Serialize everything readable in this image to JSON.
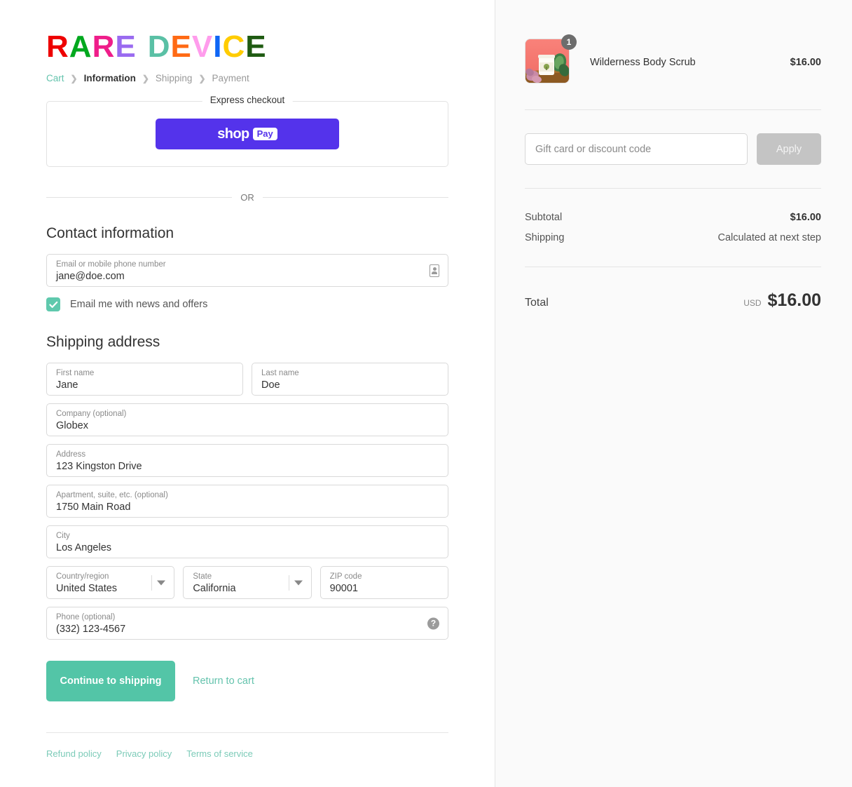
{
  "brand": {
    "letters": [
      {
        "ch": "R",
        "color": "#ee0000"
      },
      {
        "ch": "A",
        "color": "#00a81e"
      },
      {
        "ch": "R",
        "color": "#ef1d8a"
      },
      {
        "ch": "E",
        "color": "#9a6bf0"
      },
      {
        "ch": " ",
        "color": "#ffffff"
      },
      {
        "ch": "D",
        "color": "#5ac0a5"
      },
      {
        "ch": "E",
        "color": "#ff6a14"
      },
      {
        "ch": "V",
        "color": "#ff9cec"
      },
      {
        "ch": "I",
        "color": "#0f66f5"
      },
      {
        "ch": "C",
        "color": "#ffcc00"
      },
      {
        "ch": "E",
        "color": "#1f5b12"
      }
    ]
  },
  "breadcrumb": {
    "cart": "Cart",
    "information": "Information",
    "shipping": "Shipping",
    "payment": "Payment",
    "separator": "›"
  },
  "express": {
    "title": "Express checkout",
    "shoppay_word": "shop",
    "shoppay_badge": "Pay",
    "or": "OR"
  },
  "contact": {
    "heading": "Contact information",
    "email": {
      "label": "Email or mobile phone number",
      "value": "jane@doe.com"
    },
    "newsletter_label": "Email me with news and offers",
    "newsletter_checked": true
  },
  "shipping_address": {
    "heading": "Shipping address",
    "fields": [
      {
        "label": "First name",
        "value": "Jane"
      },
      {
        "label": "Last name",
        "value": "Doe"
      },
      {
        "label": "Company (optional)",
        "value": "Globex"
      },
      {
        "label": "Address",
        "value": "123 Kingston Drive"
      },
      {
        "label": "Apartment, suite, etc. (optional)",
        "value": "1750 Main Road"
      },
      {
        "label": "City",
        "value": "Los Angeles"
      },
      {
        "label": "Country/region",
        "value": "United States"
      },
      {
        "label": "State",
        "value": "California"
      },
      {
        "label": "ZIP code",
        "value": "90001"
      },
      {
        "label": "Phone (optional)",
        "value": "(332) 123-4567"
      }
    ]
  },
  "actions": {
    "continue_label": "Continue to shipping",
    "return_label": "Return to cart"
  },
  "footer": {
    "links": [
      {
        "label": "Refund policy"
      },
      {
        "label": "Privacy policy"
      },
      {
        "label": "Terms of service"
      }
    ]
  },
  "order_summary": {
    "item": {
      "name": "Wilderness Body Scrub",
      "price": "$16.00",
      "quantity": "1"
    },
    "discount": {
      "placeholder": "Gift card or discount code",
      "value": "",
      "apply_label": "Apply"
    },
    "subtotal_label": "Subtotal",
    "subtotal_value": "$16.00",
    "shipping_label": "Shipping",
    "shipping_value": "Calculated at next step",
    "total_label": "Total",
    "total_currency": "USD",
    "total_value": "$16.00"
  },
  "colors": {
    "accent_teal": "#53c5a7",
    "shoppay_purple": "#5433eb",
    "summary_bg": "#fafafa"
  }
}
